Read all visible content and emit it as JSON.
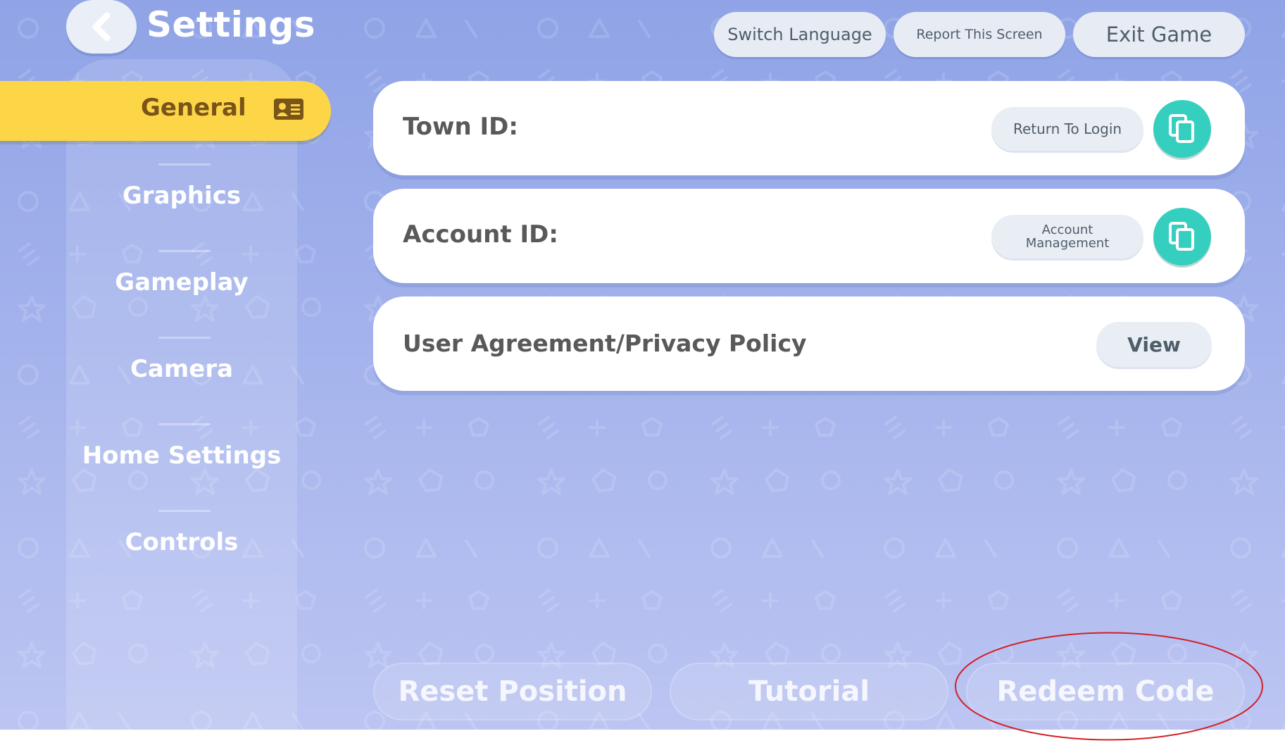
{
  "header": {
    "title": "Settings",
    "back_icon": "chevron-left-icon",
    "buttons": {
      "switch_language": "Switch Language",
      "report_screen": "Report This Screen",
      "exit_game": "Exit Game"
    }
  },
  "sidebar": {
    "active": {
      "label": "General",
      "icon": "id-card-icon"
    },
    "items": [
      {
        "label": "Graphics"
      },
      {
        "label": "Gameplay"
      },
      {
        "label": "Camera"
      },
      {
        "label": "Home Settings"
      },
      {
        "label": "Controls"
      }
    ]
  },
  "cards": {
    "town": {
      "label": "Town ID:",
      "value": "",
      "button": "Return To Login",
      "copy_icon": "copy-icon"
    },
    "account": {
      "label": "Account ID:",
      "value": "",
      "button": "Account Management",
      "copy_icon": "copy-icon"
    },
    "policy": {
      "label": "User Agreement/Privacy Policy",
      "button": "View"
    }
  },
  "footer": {
    "reset_position": "Reset Position",
    "tutorial": "Tutorial",
    "redeem_code": "Redeem Code"
  },
  "colors": {
    "background_top": "#8fa3e6",
    "active_tab": "#fdd648",
    "copy_button": "#35cfc0",
    "annotation": "#d21f26"
  }
}
